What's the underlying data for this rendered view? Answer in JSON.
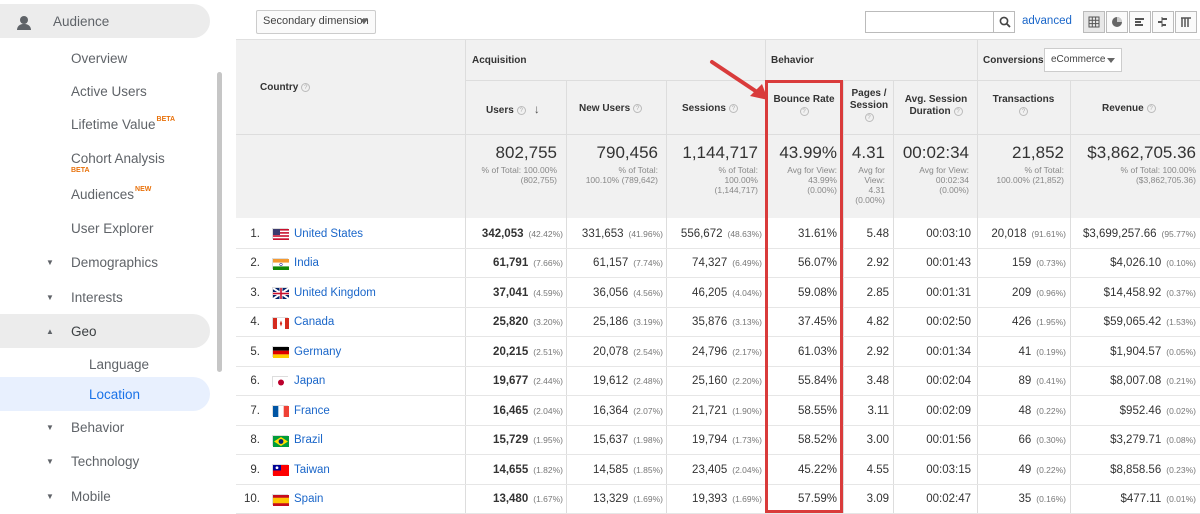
{
  "sidebar": {
    "header": "Audience",
    "items": [
      {
        "label": "Overview"
      },
      {
        "label": "Active Users"
      },
      {
        "label": "Lifetime Value",
        "badge": "BETA"
      },
      {
        "label": "Cohort Analysis",
        "badge": "BETA"
      },
      {
        "label": "Audiences",
        "badge": "NEW"
      },
      {
        "label": "User Explorer"
      },
      {
        "label": "Demographics"
      },
      {
        "label": "Interests"
      },
      {
        "label": "Geo"
      },
      {
        "label": "Language"
      },
      {
        "label": "Location"
      },
      {
        "label": "Behavior"
      },
      {
        "label": "Technology"
      },
      {
        "label": "Mobile"
      }
    ]
  },
  "toolbar": {
    "secondary_dimension": "Secondary dimension",
    "advanced": "advanced"
  },
  "table": {
    "groups": {
      "acquisition": "Acquisition",
      "behavior": "Behavior",
      "conversions": "Conversions",
      "conversions_select": "eCommerce"
    },
    "headers": {
      "country": "Country",
      "users": "Users",
      "new_users": "New Users",
      "sessions": "Sessions",
      "bounce_rate": "Bounce Rate",
      "pages_session_1": "Pages /",
      "pages_session_2": "Session",
      "avg_duration_1": "Avg. Session",
      "avg_duration_2": "Duration",
      "transactions": "Transactions",
      "revenue": "Revenue"
    },
    "totals": {
      "users": {
        "value": "802,755",
        "l1": "% of Total: 100.00%",
        "l2": "(802,755)"
      },
      "new_users": {
        "value": "790,456",
        "l1": "% of Total:",
        "l2": "100.10% (789,642)"
      },
      "sessions": {
        "value": "1,144,717",
        "l1": "% of Total:",
        "l2": "100.00%",
        "l3": "(1,144,717)"
      },
      "bounce_rate": {
        "value": "43.99%",
        "l1": "Avg for View:",
        "l2": "43.99%",
        "l3": "(0.00%)"
      },
      "pages_session": {
        "value": "4.31",
        "l1": "Avg for",
        "l2": "View:",
        "l3": "4.31",
        "l4": "(0.00%)"
      },
      "avg_duration": {
        "value": "00:02:34",
        "l1": "Avg for View:",
        "l2": "00:02:34",
        "l3": "(0.00%)"
      },
      "transactions": {
        "value": "21,852",
        "l1": "% of Total:",
        "l2": "100.00% (21,852)"
      },
      "revenue": {
        "value": "$3,862,705.36",
        "l1": "% of Total: 100.00%",
        "l2": "($3,862,705.36)"
      }
    },
    "rows": [
      {
        "rank": "1.",
        "country": "United States",
        "flag": "us",
        "users": "342,053",
        "users_pct": "(42.42%)",
        "new_users": "331,653",
        "new_users_pct": "(41.96%)",
        "sessions": "556,672",
        "sessions_pct": "(48.63%)",
        "bounce": "31.61%",
        "pages": "5.48",
        "duration": "00:03:10",
        "trans": "20,018",
        "trans_pct": "(91.61%)",
        "revenue": "$3,699,257.66",
        "revenue_pct": "(95.77%)"
      },
      {
        "rank": "2.",
        "country": "India",
        "flag": "in",
        "users": "61,791",
        "users_pct": "(7.66%)",
        "new_users": "61,157",
        "new_users_pct": "(7.74%)",
        "sessions": "74,327",
        "sessions_pct": "(6.49%)",
        "bounce": "56.07%",
        "pages": "2.92",
        "duration": "00:01:43",
        "trans": "159",
        "trans_pct": "(0.73%)",
        "revenue": "$4,026.10",
        "revenue_pct": "(0.10%)"
      },
      {
        "rank": "3.",
        "country": "United Kingdom",
        "flag": "uk",
        "users": "37,041",
        "users_pct": "(4.59%)",
        "new_users": "36,056",
        "new_users_pct": "(4.56%)",
        "sessions": "46,205",
        "sessions_pct": "(4.04%)",
        "bounce": "59.08%",
        "pages": "2.85",
        "duration": "00:01:31",
        "trans": "209",
        "trans_pct": "(0.96%)",
        "revenue": "$14,458.92",
        "revenue_pct": "(0.37%)"
      },
      {
        "rank": "4.",
        "country": "Canada",
        "flag": "ca",
        "users": "25,820",
        "users_pct": "(3.20%)",
        "new_users": "25,186",
        "new_users_pct": "(3.19%)",
        "sessions": "35,876",
        "sessions_pct": "(3.13%)",
        "bounce": "37.45%",
        "pages": "4.82",
        "duration": "00:02:50",
        "trans": "426",
        "trans_pct": "(1.95%)",
        "revenue": "$59,065.42",
        "revenue_pct": "(1.53%)"
      },
      {
        "rank": "5.",
        "country": "Germany",
        "flag": "de",
        "users": "20,215",
        "users_pct": "(2.51%)",
        "new_users": "20,078",
        "new_users_pct": "(2.54%)",
        "sessions": "24,796",
        "sessions_pct": "(2.17%)",
        "bounce": "61.03%",
        "pages": "2.92",
        "duration": "00:01:34",
        "trans": "41",
        "trans_pct": "(0.19%)",
        "revenue": "$1,904.57",
        "revenue_pct": "(0.05%)"
      },
      {
        "rank": "6.",
        "country": "Japan",
        "flag": "jp",
        "users": "19,677",
        "users_pct": "(2.44%)",
        "new_users": "19,612",
        "new_users_pct": "(2.48%)",
        "sessions": "25,160",
        "sessions_pct": "(2.20%)",
        "bounce": "55.84%",
        "pages": "3.48",
        "duration": "00:02:04",
        "trans": "89",
        "trans_pct": "(0.41%)",
        "revenue": "$8,007.08",
        "revenue_pct": "(0.21%)"
      },
      {
        "rank": "7.",
        "country": "France",
        "flag": "fr",
        "users": "16,465",
        "users_pct": "(2.04%)",
        "new_users": "16,364",
        "new_users_pct": "(2.07%)",
        "sessions": "21,721",
        "sessions_pct": "(1.90%)",
        "bounce": "58.55%",
        "pages": "3.11",
        "duration": "00:02:09",
        "trans": "48",
        "trans_pct": "(0.22%)",
        "revenue": "$952.46",
        "revenue_pct": "(0.02%)"
      },
      {
        "rank": "8.",
        "country": "Brazil",
        "flag": "br",
        "users": "15,729",
        "users_pct": "(1.95%)",
        "new_users": "15,637",
        "new_users_pct": "(1.98%)",
        "sessions": "19,794",
        "sessions_pct": "(1.73%)",
        "bounce": "58.52%",
        "pages": "3.00",
        "duration": "00:01:56",
        "trans": "66",
        "trans_pct": "(0.30%)",
        "revenue": "$3,279.71",
        "revenue_pct": "(0.08%)"
      },
      {
        "rank": "9.",
        "country": "Taiwan",
        "flag": "tw",
        "users": "14,655",
        "users_pct": "(1.82%)",
        "new_users": "14,585",
        "new_users_pct": "(1.85%)",
        "sessions": "23,405",
        "sessions_pct": "(2.04%)",
        "bounce": "45.22%",
        "pages": "4.55",
        "duration": "00:03:15",
        "trans": "49",
        "trans_pct": "(0.22%)",
        "revenue": "$8,858.56",
        "revenue_pct": "(0.23%)"
      },
      {
        "rank": "10.",
        "country": "Spain",
        "flag": "es",
        "users": "13,480",
        "users_pct": "(1.67%)",
        "new_users": "13,329",
        "new_users_pct": "(1.69%)",
        "sessions": "19,393",
        "sessions_pct": "(1.69%)",
        "bounce": "57.59%",
        "pages": "3.09",
        "duration": "00:02:47",
        "trans": "35",
        "trans_pct": "(0.16%)",
        "revenue": "$477.11",
        "revenue_pct": "(0.01%)"
      }
    ]
  },
  "colors": {
    "link": "#1a66c9",
    "highlight": "#d93b3b",
    "badge": "#e8710a",
    "active": "#1a73e8"
  }
}
